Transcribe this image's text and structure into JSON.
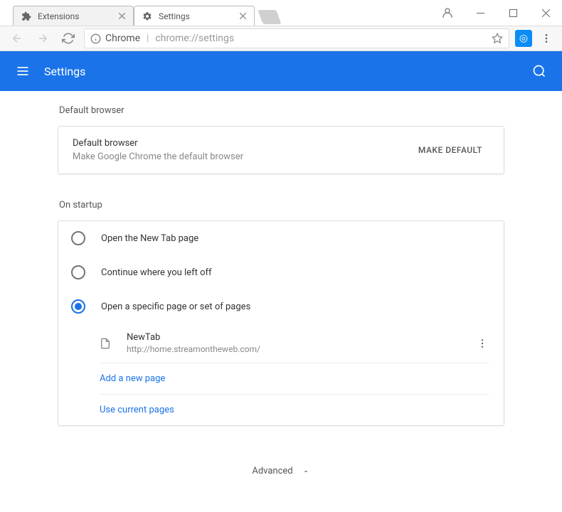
{
  "window": {
    "tabs": [
      {
        "title": "Extensions",
        "active": false,
        "icon": "puzzle"
      },
      {
        "title": "Settings",
        "active": true,
        "icon": "gear"
      }
    ]
  },
  "addressbar": {
    "label": "Chrome",
    "url": "chrome://settings"
  },
  "header": {
    "title": "Settings"
  },
  "default_browser": {
    "section_label": "Default browser",
    "row_title": "Default browser",
    "row_sub": "Make Google Chrome the default browser",
    "button": "MAKE DEFAULT"
  },
  "startup": {
    "section_label": "On startup",
    "options": [
      {
        "label": "Open the New Tab page"
      },
      {
        "label": "Continue where you left off"
      },
      {
        "label": "Open a specific page or set of pages"
      }
    ],
    "selected_index": 2,
    "pages": [
      {
        "title": "NewTab",
        "url": "http://home.streamontheweb.com/"
      }
    ],
    "add_page": "Add a new page",
    "use_current": "Use current pages"
  },
  "advanced": {
    "label": "Advanced"
  }
}
